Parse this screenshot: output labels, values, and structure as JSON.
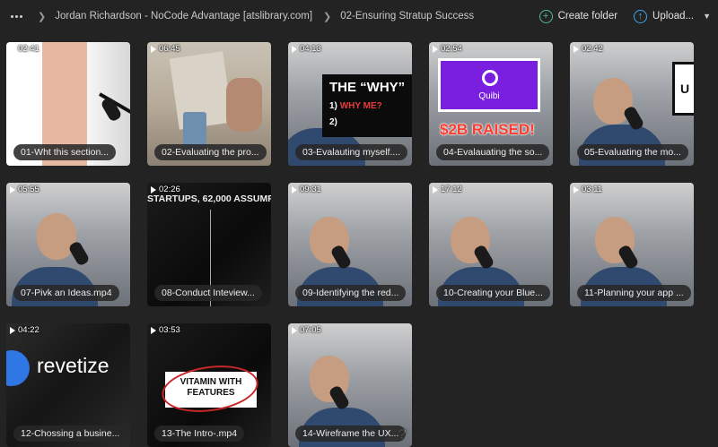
{
  "topbar": {
    "breadcrumbs": [
      "Jordan Richardson - NoCode Advantage [atslibrary.com]",
      "02-Ensuring Stratup Success"
    ],
    "create_folder_label": "Create folder",
    "upload_label": "Upload...",
    "create_folder_icon": "plus-circle-icon",
    "upload_icon": "upload-arrow-icon"
  },
  "thumb_text": {
    "why_title": "THE “WHY”",
    "why_1_num": "1)",
    "why_1_text": "WHY ME?",
    "why_2": "2)",
    "quibi": "Quibi",
    "raised": "$2B RAISED!",
    "startups": "STARTUPS, 62,000 ASSUMP",
    "revetize": "revetize",
    "vitamin": "VITAMIN WITH FEATURES",
    "sign_u": "U",
    "question": "?"
  },
  "videos": [
    {
      "duration": "02:41",
      "title": "01-Wht this section..."
    },
    {
      "duration": "06:45",
      "title": "02-Evaluating the pro..."
    },
    {
      "duration": "04:13",
      "title": "03-Evalauting myself...."
    },
    {
      "duration": "02:54",
      "title": "04-Evalauating the so..."
    },
    {
      "duration": "02:42",
      "title": "05-Evaluating the mo..."
    },
    {
      "duration": "05:55",
      "title": "07-Pivk an Ideas.mp4"
    },
    {
      "duration": "02:26",
      "title": "08-Conduct Inteview..."
    },
    {
      "duration": "09:31",
      "title": "09-Identifying the red..."
    },
    {
      "duration": "17:12",
      "title": "10-Creating your Blue..."
    },
    {
      "duration": "03:11",
      "title": "11-Planning your app ..."
    },
    {
      "duration": "04:22",
      "title": "12-Chossing a busine..."
    },
    {
      "duration": "03:53",
      "title": "13-The Intro-.mp4"
    },
    {
      "duration": "07:05",
      "title": "14-Wireframe the UX..."
    }
  ]
}
